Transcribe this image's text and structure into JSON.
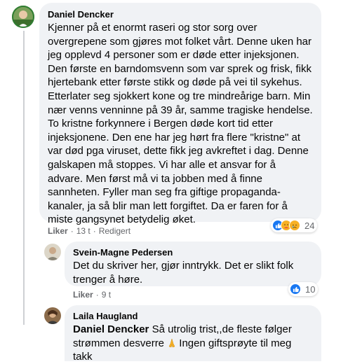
{
  "comments": [
    {
      "author": "Daniel Dencker",
      "text": "Kjenner på et enormt raseri og stor sorg over overgrepene som gjøres mot folket vårt. Denne uken har jeg opplevd 4 personer som er døde etter injeksjonen. Den første en barndomsvenn som var sprek og frisk, fikk hjertebank etter første stikk og døde på vei til sykehus. Etterlater seg sjokkert kone og tre mindreårige barn. Min nær venns venninne på 39 år, samme tragiske hendelse. To kristne forkynnere i Bergen døde kort tid etter injeksjonene. Den ene har jeg hørt fra flere \"kristne\" at var død pga viruset, dette fikk jeg avkreftet i dag. Denne galskapen må stoppes. Vi har alle et ansvar for å advare. Men først må vi ta jobben med å finne sannheten. Fyller man seg fra giftige propaganda-kanaler, ja så blir man lett forgiftet. Da er faren for å miste gangsynet betydelig øket.",
      "like_label": "Liker",
      "time": "13 t",
      "edited": "Redigert",
      "reaction_count": "24"
    },
    {
      "author": "Svein-Magne Pedersen",
      "text": "Det du skriver her, gjør inntrykk. Det er slikt folk trenger å høre.",
      "like_label": "Liker",
      "time": "9 t",
      "reaction_count": "10"
    },
    {
      "author": "Laila Haugland",
      "mention": "Daniel Dencker",
      "text": "Så utrolig trist,,de fleste følger strømmen desverre",
      "text_after": "Ingen giftsprøyte til meg takk"
    }
  ],
  "icons": {
    "reactions_main": [
      "like-icon",
      "care-icon",
      "sad-icon"
    ],
    "reactions_reply": [
      "like-icon"
    ],
    "pray": "folded-hands-icon"
  },
  "colors": {
    "bubble": "#f0f2f5",
    "like_blue": "#1877f2",
    "meta_gray": "#65676b"
  }
}
